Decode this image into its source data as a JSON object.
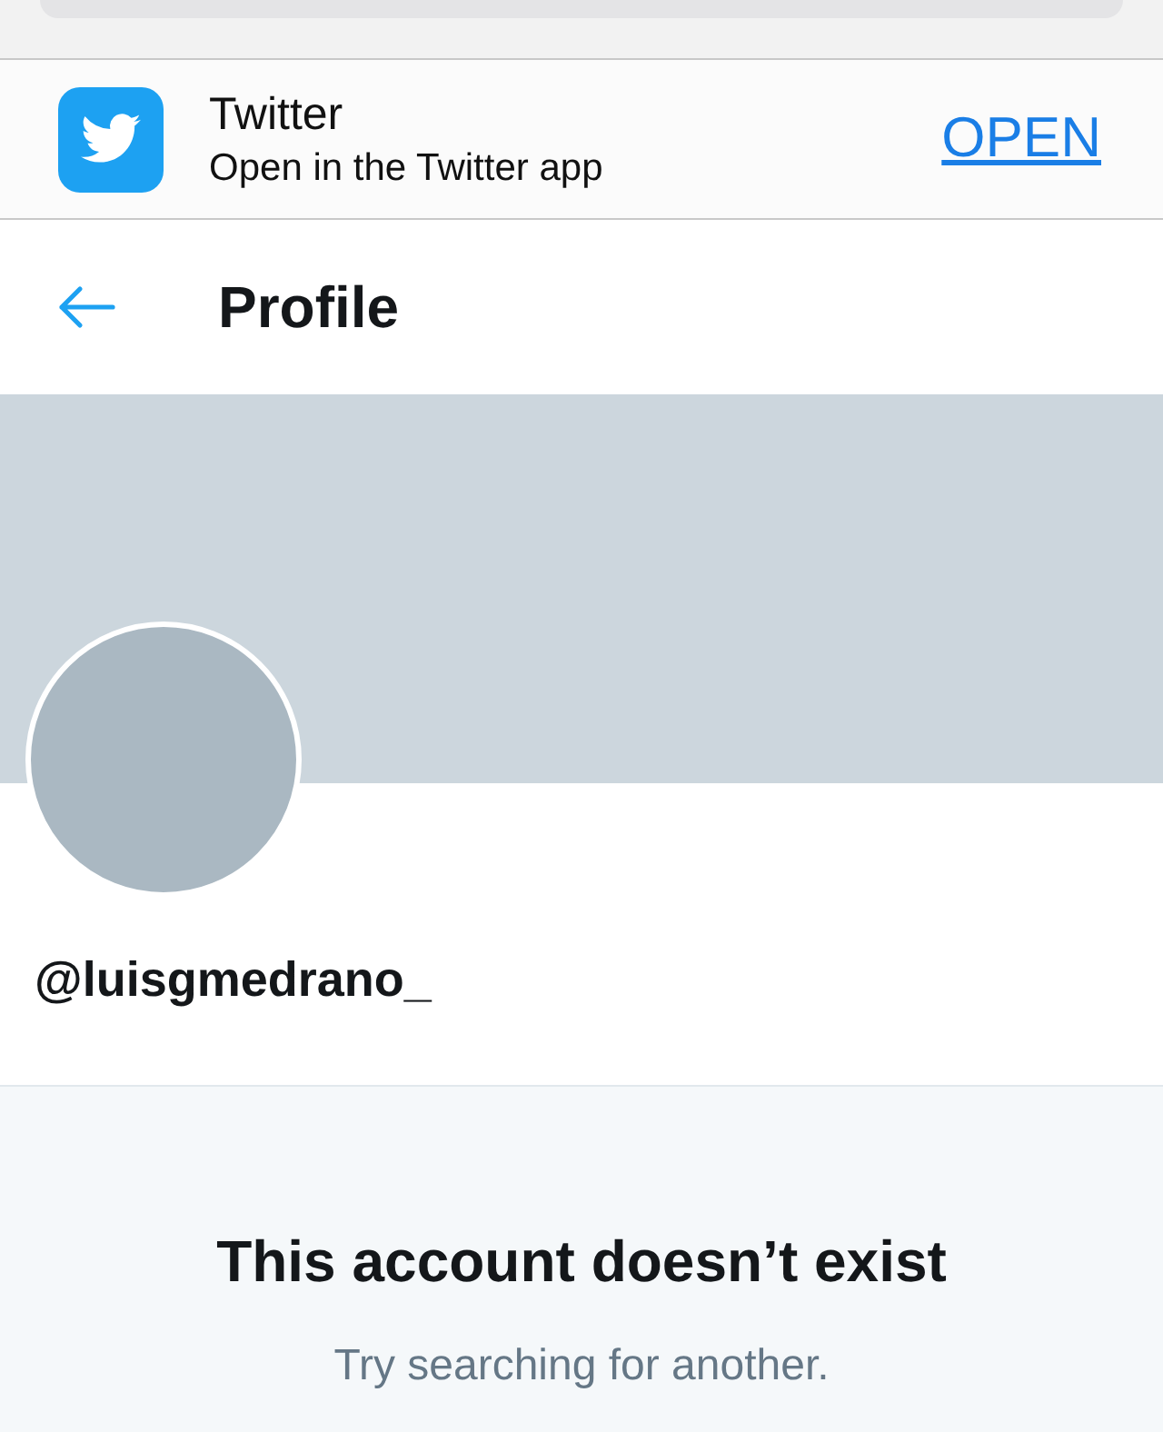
{
  "app_banner": {
    "app_name": "Twitter",
    "subtitle": "Open in the Twitter app",
    "open_label": "OPEN"
  },
  "header": {
    "title": "Profile"
  },
  "profile": {
    "handle": "@luisgmedrano_"
  },
  "empty_state": {
    "title": "This account doesn’t exist",
    "message": "Try searching for another."
  }
}
